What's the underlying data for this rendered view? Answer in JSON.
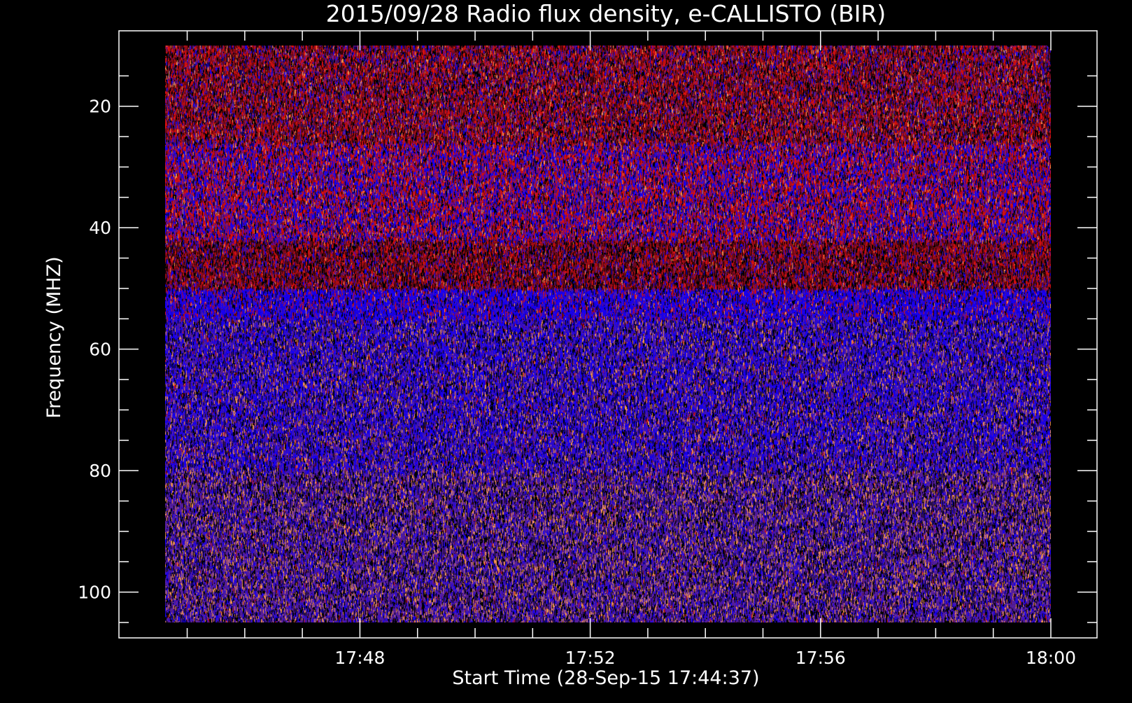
{
  "chart_data": {
    "type": "heatmap",
    "title": "2015/09/28  Radio flux density, e-CALLISTO (BIR)",
    "xlabel": "Start Time (28-Sep-15 17:44:37)",
    "ylabel": "Frequency (MHZ)",
    "x_range": [
      "17:44:37",
      "18:00:00"
    ],
    "ylim": [
      105,
      10
    ],
    "x_ticks": [
      "17:48",
      "17:52",
      "17:56",
      "18:00"
    ],
    "y_ticks": [
      20,
      40,
      60,
      80,
      100
    ],
    "colormap": {
      "low": "#000000",
      "mid_low": "#5a1fa8",
      "mid": "#1a00ff",
      "mid_high": "#e01010",
      "high": "#ff9a55"
    },
    "frequency_bands": [
      {
        "freq_from": 10,
        "freq_to": 26,
        "dominant": "dark-red"
      },
      {
        "freq_from": 26,
        "freq_to": 42,
        "dominant": "red-blue mix"
      },
      {
        "freq_from": 42,
        "freq_to": 50,
        "dominant": "dark-red band"
      },
      {
        "freq_from": 50,
        "freq_to": 55,
        "dominant": "blue"
      },
      {
        "freq_from": 55,
        "freq_to": 80,
        "dominant": "blue-violet"
      },
      {
        "freq_from": 80,
        "freq_to": 105,
        "dominant": "violet-orange speckle"
      }
    ],
    "grid": false,
    "legend": "none"
  },
  "colors": {
    "background": "#000000",
    "axes": "#ffffff",
    "text": "#ffffff"
  }
}
